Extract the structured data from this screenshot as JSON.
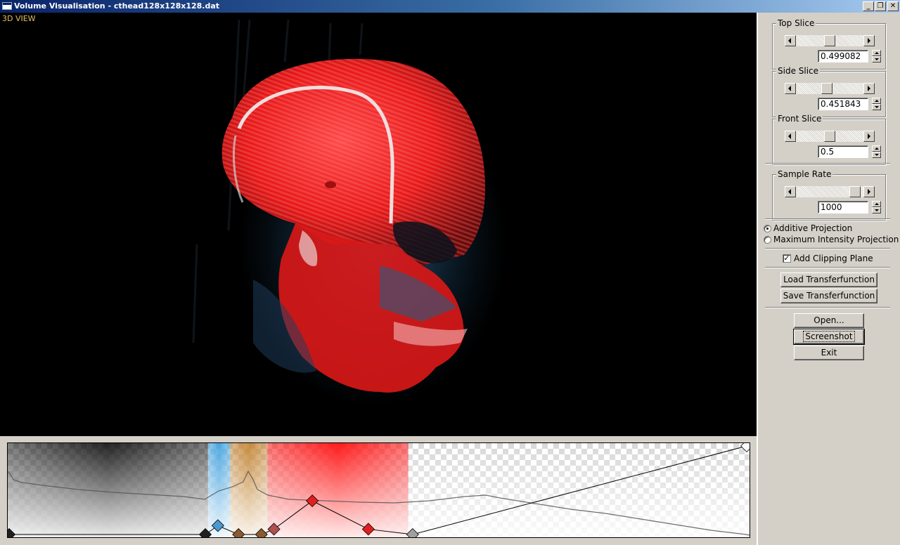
{
  "window": {
    "title": "Volume Visualisation - cthead128x128x128.dat",
    "minimize_glyph": "_",
    "restore_glyph": "❐",
    "close_glyph": "✕"
  },
  "view": {
    "label": "3D VIEW"
  },
  "controls": {
    "top_slice": {
      "label": "Top Slice",
      "value": "0.499082",
      "level": 0.5
    },
    "side_slice": {
      "label": "Side Slice",
      "value": "0.451843",
      "level": 0.45
    },
    "front_slice": {
      "label": "Front Slice",
      "value": "0.5",
      "level": 0.5
    },
    "sample_rate": {
      "label": "Sample Rate",
      "value": "1000",
      "level": 0.95
    },
    "projection": {
      "additive": "Additive Projection",
      "mip": "Maximum Intensity Projection",
      "selected": "additive"
    },
    "clipping": {
      "label": "Add Clipping Plane",
      "checked": true,
      "check_glyph": "✓"
    },
    "buttons": {
      "load_tf": "Load Transferfunction",
      "save_tf": "Save Transferfunction",
      "open": "Open...",
      "screenshot": "Screenshot",
      "exit": "Exit"
    }
  },
  "transfer_function": {
    "control_points": [
      {
        "intensity": 0.0,
        "opacity": 0.0,
        "color": "#202020"
      },
      {
        "intensity": 0.266,
        "opacity": 0.0,
        "color": "#202020"
      },
      {
        "intensity": 0.283,
        "opacity": 0.1,
        "color": "#4a9ad0"
      },
      {
        "intensity": 0.311,
        "opacity": 0.0,
        "color": "#8a5a30"
      },
      {
        "intensity": 0.342,
        "opacity": 0.0,
        "color": "#8a5a30"
      },
      {
        "intensity": 0.359,
        "opacity": 0.06,
        "color": "#b05050"
      },
      {
        "intensity": 0.411,
        "opacity": 0.38,
        "color": "#e02020"
      },
      {
        "intensity": 0.487,
        "opacity": 0.06,
        "color": "#e02020"
      },
      {
        "intensity": 0.547,
        "opacity": 0.0,
        "color": "#a0a0a0"
      },
      {
        "intensity": 1.0,
        "opacity": 1.0,
        "color": "#ffffff"
      }
    ],
    "color_bands": [
      {
        "from": 0.0,
        "to": 0.27,
        "color": "#000000",
        "strength": 0.85
      },
      {
        "from": 0.27,
        "to": 0.3,
        "color": "#3a9fe0",
        "strength": 0.9
      },
      {
        "from": 0.3,
        "to": 0.35,
        "color": "#c07a20",
        "strength": 0.85
      },
      {
        "from": 0.35,
        "to": 0.54,
        "color": "#ff1010",
        "strength": 0.95
      }
    ]
  }
}
